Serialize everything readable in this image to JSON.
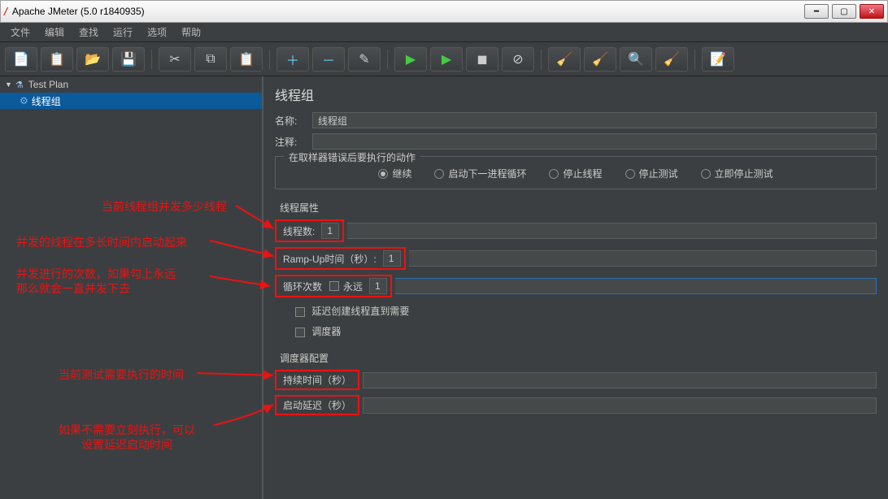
{
  "window": {
    "title": "Apache JMeter (5.0 r1840935)"
  },
  "menu": {
    "file": "文件",
    "edit": "编辑",
    "search": "查找",
    "run": "运行",
    "options": "选项",
    "help": "帮助"
  },
  "tree": {
    "root": "Test Plan",
    "child": "线程组"
  },
  "panel": {
    "title": "线程组",
    "name_label": "名称:",
    "name_value": "线程组",
    "comment_label": "注释:",
    "comment_value": "",
    "error_group": "在取样器错误后要执行的动作",
    "radios": {
      "continue": "继续",
      "next_loop": "启动下一进程循环",
      "stop_thread": "停止线程",
      "stop_test": "停止测试",
      "stop_now": "立即停止测试"
    },
    "thread_props": "线程属性",
    "num_threads_label": "线程数:",
    "num_threads_value": "1",
    "rampup_label": "Ramp-Up时间（秒）:",
    "rampup_value": "1",
    "loop_label": "循环次数",
    "forever_label": "永远",
    "loop_value": "1",
    "delay_create_label": "延迟创建线程直到需要",
    "scheduler_label": "调度器",
    "sched_config": "调度器配置",
    "duration_label": "持续时间（秒）",
    "duration_value": "",
    "startup_delay_label": "启动延迟（秒）",
    "startup_delay_value": ""
  },
  "annotations": {
    "a1": "当前线程组并发多少线程",
    "a2": "并发的线程在多长时间内启动起来",
    "a3a": "并发进行的次数，如果勾上永远",
    "a3b": "那么就会一直并发下去",
    "a4": "当前测试需要执行的时间",
    "a5a": "如果不需要立刻执行，可以",
    "a5b": "设置延迟启动时间"
  }
}
